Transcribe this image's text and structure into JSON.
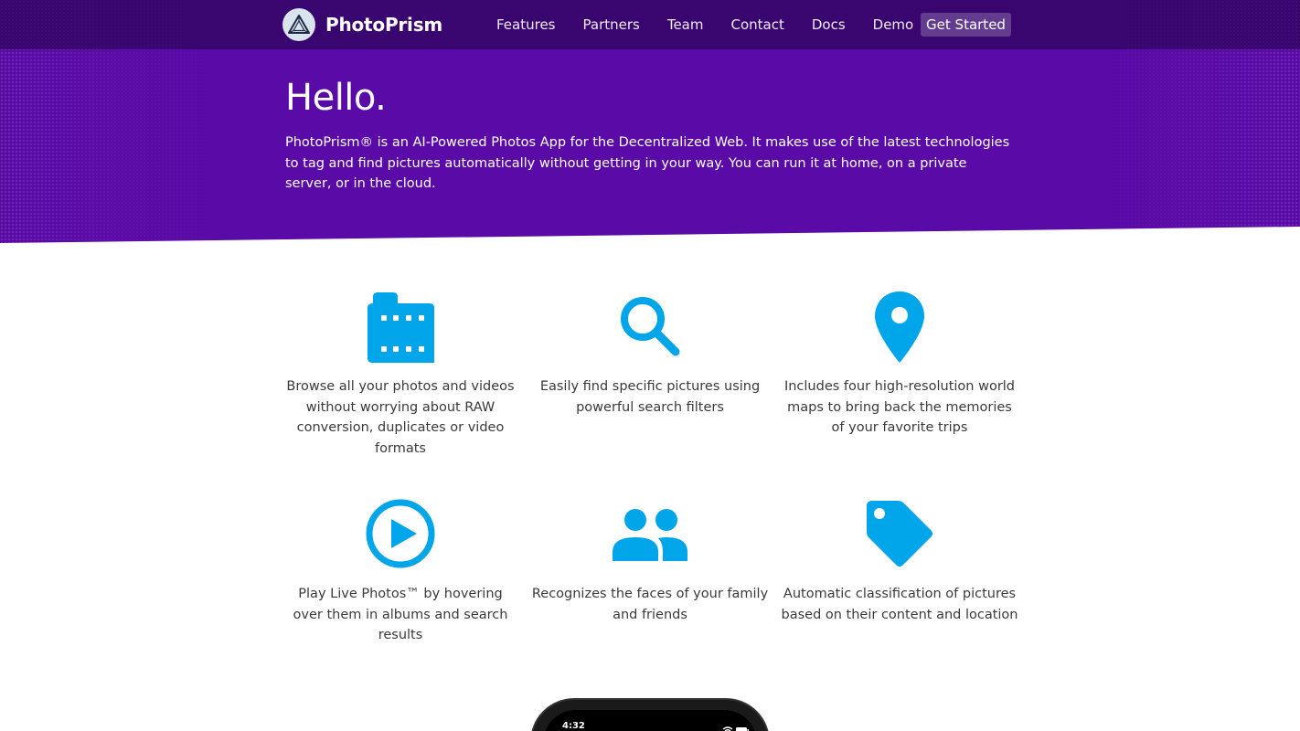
{
  "nav": {
    "brand": "PhotoPrism",
    "links": [
      "Features",
      "Partners",
      "Team",
      "Contact",
      "Docs",
      "Demo"
    ],
    "cta": "Get Started"
  },
  "hero": {
    "title": "Hello.",
    "text": "PhotoPrism® is an AI-Powered Photos App for the Decentralized Web. It makes use of the latest technologies to tag and find pictures automatically without getting in your way. You can run it at home, on a private server, or in the cloud."
  },
  "features": [
    {
      "icon": "film-icon",
      "text": "Browse all your photos and videos without worrying about RAW conversion, duplicates or video formats"
    },
    {
      "icon": "search-icon",
      "text": "Easily find specific pictures using powerful search filters"
    },
    {
      "icon": "map-pin-icon",
      "text": "Includes four high-resolution world maps to bring back the memories of your favorite trips"
    },
    {
      "icon": "play-circle-icon",
      "text": "Play Live Photos™ by hovering over them in albums and search results"
    },
    {
      "icon": "people-icon",
      "text": "Recognizes the faces of your family and friends"
    },
    {
      "icon": "tag-icon",
      "text": "Automatic classification of pictures based on their content and location"
    }
  ],
  "phone": {
    "time": "4:32"
  },
  "colors": {
    "hero": "#5a0aa6",
    "navbar": "#2d065c",
    "icon": "#00a6e9"
  }
}
